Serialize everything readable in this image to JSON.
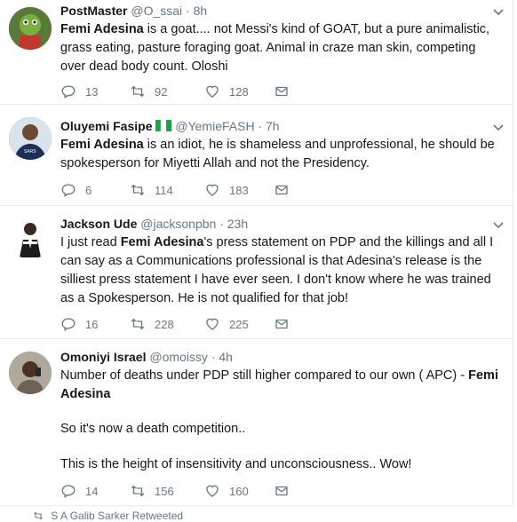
{
  "tweets": [
    {
      "name": "PostMaster",
      "handle": "@O_ssai",
      "time": "8h",
      "bold": "Femi Adesina",
      "text": " is a goat.... not Messi's kind of GOAT, but a pure animalistic, grass eating, pasture foraging goat. Animal in craze man skin, competing over dead body count. Oloshi",
      "replies": "13",
      "retweets": "92",
      "likes": "128"
    },
    {
      "name": "Oluyemi Fasipe",
      "handle": "@YemieFASH",
      "time": "7h",
      "bold": "Femi Adesina",
      "text": " is an idiot, he is shameless and unprofessional, he should be spokesperson for Miyetti Allah and not the Presidency.",
      "replies": "6",
      "retweets": "114",
      "likes": "183"
    },
    {
      "name": "Jackson Ude",
      "handle": "@jacksonpbn",
      "time": "23h",
      "pre": "I just read ",
      "bold": "Femi Adesina",
      "text": "'s press statement on PDP and the killings and all I can say as a Communications professional is that Adesina's release is the silliest press statement I have ever seen. I don't know where he was trained as a Spokesperson. He is not qualified for that job!",
      "replies": "16",
      "retweets": "228",
      "likes": "225"
    },
    {
      "name": "Omoniyi Israel",
      "handle": "@omoissy",
      "time": "4h",
      "pre": "Number of deaths under PDP still higher compared to our own ( APC) - ",
      "bold": "Femi Adesina",
      "line2": "So it's now a death competition..",
      "line3": "This is the height of insensitivity and unconsciousness.. Wow!",
      "replies": "14",
      "retweets": "156",
      "likes": "160"
    }
  ],
  "footer": {
    "text": "S A Galib Sarker Retweeted"
  },
  "colors": {
    "text": "#14171a",
    "muted": "#657786",
    "border": "#e6ecf0"
  },
  "icons": [
    "reply-icon",
    "retweet-icon",
    "like-icon",
    "message-icon",
    "chevron-down-icon",
    "nigeria-flag-icon"
  ]
}
